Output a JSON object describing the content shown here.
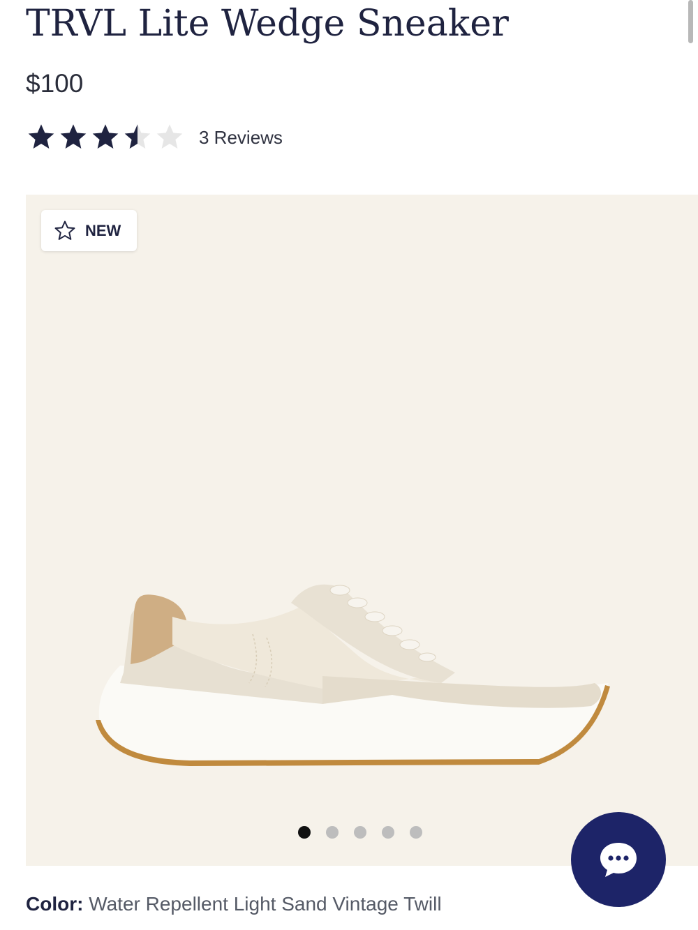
{
  "product": {
    "title": "TRVL Lite Wedge Sneaker",
    "price": "$100",
    "rating": 3.5,
    "rating_max": 5,
    "reviews_label": "3 Reviews"
  },
  "gallery": {
    "badge_label": "NEW",
    "badge_icon": "star-outline-icon",
    "slide_count": 5,
    "active_slide": 1
  },
  "color": {
    "label": "Color:",
    "value": "Water Repellent Light Sand Vintage Twill"
  },
  "chat": {
    "icon": "chat-bubble-icon"
  },
  "colors": {
    "text_primary": "#1f2340",
    "star_filled": "#1f2340",
    "star_empty": "#e6e6e6",
    "gallery_bg": "#f6f2ea",
    "chat_bg": "#1d2468"
  }
}
